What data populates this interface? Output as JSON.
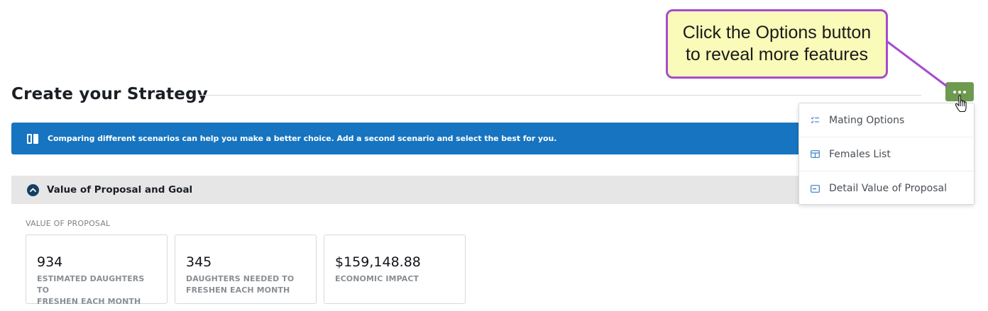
{
  "callout": {
    "line1": "Click the Options button",
    "line2": "to reveal more features"
  },
  "page": {
    "title": "Create your Strategy"
  },
  "options_button": {
    "icon": "more-horizontal-icon",
    "color": "#6e9a4f"
  },
  "options_menu": {
    "items": [
      {
        "label": "Mating Options",
        "icon": "checklist-icon"
      },
      {
        "label": "Females List",
        "icon": "table-icon"
      },
      {
        "label": "Detail Value of Proposal",
        "icon": "card-icon"
      }
    ]
  },
  "banner": {
    "icon": "compare-columns-icon",
    "text": "Comparing different scenarios can help you make a better choice. Add a second scenario and select the best for you.",
    "color": "#1674c0"
  },
  "section": {
    "title": "Value of Proposal and Goal",
    "icon": "chevron-up-icon",
    "sub_label": "VALUE OF PROPOSAL",
    "cards": [
      {
        "value": "934",
        "label_line1": "ESTIMATED DAUGHTERS TO",
        "label_line2": "FRESHEN EACH MONTH"
      },
      {
        "value": "345",
        "label_line1": "DAUGHTERS NEEDED TO",
        "label_line2": "FRESHEN EACH MONTH"
      },
      {
        "value": "$159,148.88",
        "label_line1": "ECONOMIC IMPACT",
        "label_line2": ""
      }
    ]
  }
}
